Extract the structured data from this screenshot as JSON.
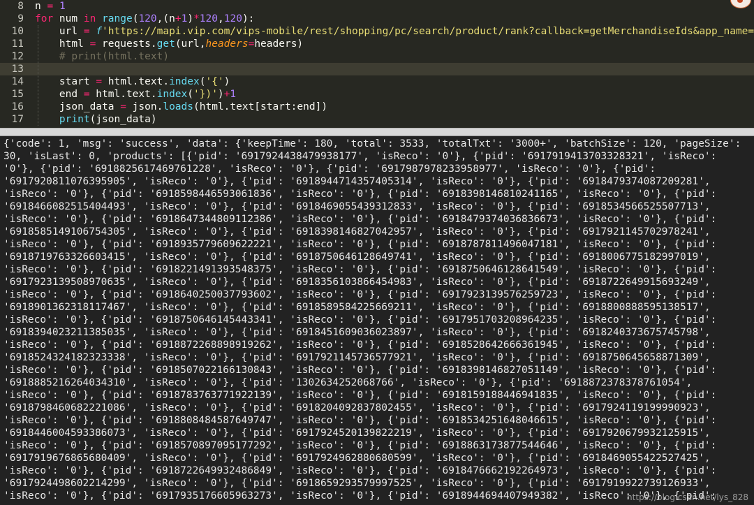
{
  "editor": {
    "lines": [
      {
        "num": "8",
        "tokens": [
          [
            "n",
            ""
          ],
          [
            " = ",
            "op"
          ],
          [
            "1",
            "num"
          ]
        ]
      },
      {
        "num": "9",
        "tokens": [
          [
            "for",
            "kw"
          ],
          [
            " num ",
            ""
          ],
          [
            "in",
            "kw"
          ],
          [
            " ",
            ""
          ],
          [
            "range",
            "bi"
          ],
          [
            "(",
            ""
          ],
          [
            "120",
            "num"
          ],
          [
            ",(n",
            ""
          ],
          [
            "+",
            "op"
          ],
          [
            "1",
            "num"
          ],
          [
            ")",
            ""
          ],
          [
            "*",
            "op"
          ],
          [
            "120",
            "num"
          ],
          [
            ",",
            ""
          ],
          [
            "120",
            "num"
          ],
          [
            "):",
            ""
          ]
        ]
      },
      {
        "num": "10",
        "tokens": [
          [
            "    url ",
            ""
          ],
          [
            "=",
            "op"
          ],
          [
            " ",
            ""
          ],
          [
            "f",
            "fp"
          ],
          [
            "'https://mapi.vip.com/vips-mobile/rest/shopping/pc/search/product/rank?callback=getMerchandiseIds&app_name=",
            "str"
          ]
        ]
      },
      {
        "num": "11",
        "tokens": [
          [
            "    html ",
            ""
          ],
          [
            "=",
            "op"
          ],
          [
            " requests.",
            ""
          ],
          [
            "get",
            "bi"
          ],
          [
            "(url,",
            ""
          ],
          [
            "headers",
            "pm"
          ],
          [
            "=",
            "op"
          ],
          [
            "headers)",
            ""
          ]
        ]
      },
      {
        "num": "12",
        "tokens": [
          [
            "    # print(html.text)",
            "cm"
          ]
        ]
      },
      {
        "num": "13",
        "tokens": [
          [
            "",
            ""
          ]
        ]
      },
      {
        "num": "14",
        "tokens": [
          [
            "    start ",
            ""
          ],
          [
            "=",
            "op"
          ],
          [
            " html.text.",
            ""
          ],
          [
            "index",
            "bi"
          ],
          [
            "(",
            ""
          ],
          [
            "'{'",
            "str"
          ],
          [
            ")",
            ""
          ]
        ]
      },
      {
        "num": "15",
        "tokens": [
          [
            "    end ",
            ""
          ],
          [
            "=",
            "op"
          ],
          [
            " html.text.",
            ""
          ],
          [
            "index",
            "bi"
          ],
          [
            "(",
            ""
          ],
          [
            "'})'",
            "str"
          ],
          [
            ")",
            ""
          ],
          [
            "+",
            "op"
          ],
          [
            "1",
            "num"
          ]
        ]
      },
      {
        "num": "16",
        "tokens": [
          [
            "    json_data ",
            ""
          ],
          [
            "=",
            "op"
          ],
          [
            " json.",
            ""
          ],
          [
            "loads",
            "bi"
          ],
          [
            "(html.text[start:end])",
            ""
          ]
        ]
      },
      {
        "num": "17",
        "tokens": [
          [
            "    ",
            ""
          ],
          [
            "print",
            "bi"
          ],
          [
            "(json_data)",
            ""
          ]
        ]
      }
    ],
    "current_line_index": 5
  },
  "console": {
    "lines": [
      "{'code': 1, 'msg': 'success', 'data': {'keepTime': 180, 'total': 3533, 'totalTxt': '3000+', 'batchSize': 120, 'pageSize':",
      "30, 'isLast': 0, 'products': [{'pid': '6917924438479938177', 'isReco': '0'}, {'pid': '6917919413703328321', 'isReco':",
      "'0'}, {'pid': '6918825617469761228', 'isReco': '0'}, {'pid': '6917987978233958977', 'isReco': '0'}, {'pid':",
      "'6917920811076395905', 'isReco': '0'}, {'pid': '6918944714357405314', 'isReco': '0'}, {'pid': '6918479374087209281',",
      "'isReco': '0'}, {'pid': '6918598446593061836', 'isReco': '0'}, {'pid': '6918398146810241165', 'isReco': '0'}, {'pid':",
      "'6918466082515404493', 'isReco': '0'}, {'pid': '6918469055439312833', 'isReco': '0'}, {'pid': '6918534566525507713',",
      "'isReco': '0'}, {'pid': '6918647344809112386', 'isReco': '0'}, {'pid': '6918479374036836673', 'isReco': '0'}, {'pid':",
      "'6918585149106754305', 'isReco': '0'}, {'pid': '6918398146827042957', 'isReco': '0'}, {'pid': '6917921145702978241',",
      "'isReco': '0'}, {'pid': '6918935779609622221', 'isReco': '0'}, {'pid': '6918787811496047181', 'isReco': '0'}, {'pid':",
      "'6918719763326603415', 'isReco': '0'}, {'pid': '6918750646128649741', 'isReco': '0'}, {'pid': '6918006775182997019',",
      "'isReco': '0'}, {'pid': '6918221491393548375', 'isReco': '0'}, {'pid': '6918750646128641549', 'isReco': '0'}, {'pid':",
      "'6917923139508970635', 'isReco': '0'}, {'pid': '6918356103866454983', 'isReco': '0'}, {'pid': '6918722649915693249',",
      "'isReco': '0'}, {'pid': '6918640250037793602', 'isReco': '0'}, {'pid': '6917923139576259723', 'isReco': '0'}, {'pid':",
      "'6918901362318117467', 'isReco': '0'}, {'pid': '6918589584225669211', 'isReco': '0'}, {'pid': '6918800888595138517',",
      "'isReco': '0'}, {'pid': '6918750646145443341', 'isReco': '0'}, {'pid': '6917951703208964235', 'isReco': '0'}, {'pid':",
      "'6918394023211385035', 'isReco': '0'}, {'pid': '6918451609036023897', 'isReco': '0'}, {'pid': '6918240373675745798',",
      "'isReco': '0'}, {'pid': '6918872268898919262', 'isReco': '0'}, {'pid': '6918528642666361945', 'isReco': '0'}, {'pid':",
      "'6918524324182323338', 'isReco': '0'}, {'pid': '6917921145736577921', 'isReco': '0'}, {'pid': '6918750645658871309',",
      "'isReco': '0'}, {'pid': '6918507022166130843', 'isReco': '0'}, {'pid': '6918398146827051149', 'isReco': '0'}, {'pid':",
      "'6918885216264034310', 'isReco': '0'}, {'pid': '1302634252068766', 'isReco': '0'}, {'pid': '6918872378378761054',",
      "'isReco': '0'}, {'pid': '6918783763771922139', 'isReco': '0'}, {'pid': '6918159188446941835', 'isReco': '0'}, {'pid':",
      "'6918798460682221086', 'isReco': '0'}, {'pid': '6918204092837802455', 'isReco': '0'}, {'pid': '6917924119199990923',",
      "'isReco': '0'}, {'pid': '6918808484587649747', 'isReco': '0'}, {'pid': '6918534251648046615', 'isReco': '0'}, {'pid':",
      "'6918446004593386073', 'isReco': '0'}, {'pid': '6917924520139822219', 'isReco': '0'}, {'pid': '6917920679932125915',",
      "'isReco': '0'}, {'pid': '6918570897095177292', 'isReco': '0'}, {'pid': '6918863173877544646', 'isReco': '0'}, {'pid':",
      "'6917919676865680409', 'isReco': '0'}, {'pid': '6917924962880680599', 'isReco': '0'}, {'pid': '6918469055422527425',",
      "'isReco': '0'}, {'pid': '6918722649932486849', 'isReco': '0'}, {'pid': '6918476662192264973', 'isReco': '0'}, {'pid':",
      "'6917924498602214299', 'isReco': '0'}, {'pid': '6918659293579997525', 'isReco': '0'}, {'pid': '6917919922739126933',",
      "'isReco': '0'}, {'pid': '6917935176605963273', 'isReco': '0'}, {'pid': '6918944694407949382', 'isReco': '0'}, {'pid':"
    ]
  },
  "watermark": "https://blog.csdn.net/lys_828"
}
